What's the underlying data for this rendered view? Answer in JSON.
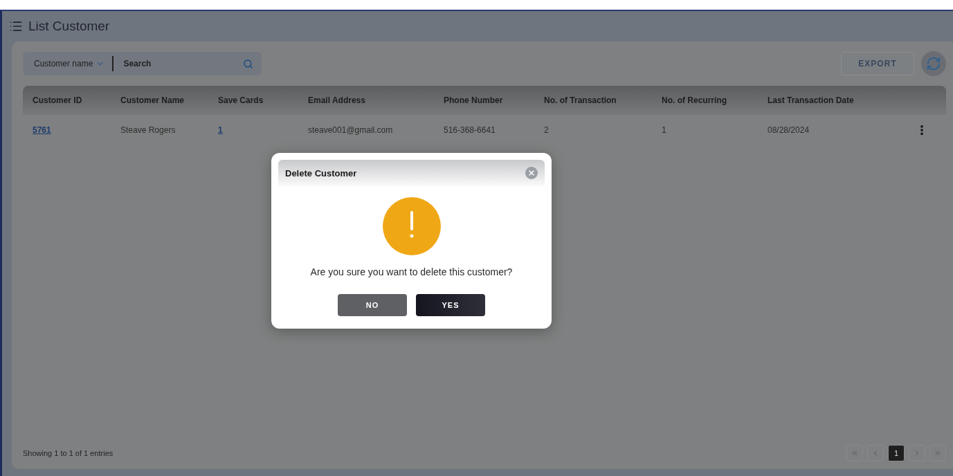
{
  "page": {
    "title": "List Customer"
  },
  "search": {
    "filter": "Customer name",
    "placeholder": "Search"
  },
  "toolbar": {
    "export": "EXPORT"
  },
  "table": {
    "columns": [
      "Customer ID",
      "Customer Name",
      "Save Cards",
      "Email Address",
      "Phone Number",
      "No. of Transaction",
      "No. of Recurring",
      "Last Transaction Date"
    ],
    "rows": [
      {
        "cells": [
          {
            "text": "5761",
            "kind": "link"
          },
          {
            "text": "Steave Rogers",
            "kind": "text"
          },
          {
            "text": "1",
            "kind": "link"
          },
          {
            "text": "steave001@gmail.com",
            "kind": "text"
          },
          {
            "text": "516-368-6641",
            "kind": "text"
          },
          {
            "text": "2",
            "kind": "text"
          },
          {
            "text": "1",
            "kind": "text"
          },
          {
            "text": "08/28/2024",
            "kind": "text"
          }
        ]
      }
    ]
  },
  "footer": {
    "summary": "Showing 1 to 1 of 1 entries",
    "pages": [
      {
        "label": "1",
        "selected": true
      }
    ]
  },
  "dialog": {
    "title": "Delete Customer",
    "message": "Are you sure you want to delete this customer?",
    "buttons": [
      {
        "label": "NO",
        "kind": "secondary"
      },
      {
        "label": "YES",
        "kind": "primary"
      }
    ]
  }
}
